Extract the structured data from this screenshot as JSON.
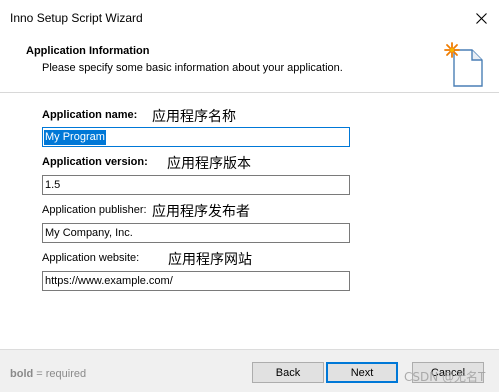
{
  "window": {
    "title": "Inno Setup Script Wizard",
    "close_icon": "close-icon"
  },
  "header": {
    "title": "Application Information",
    "subtitle": "Please specify some basic information about your application.",
    "icon": "wizard-document-sparkle-icon"
  },
  "fields": {
    "name": {
      "label": "Application name:",
      "annotation": "应用程序名称",
      "value": "My Program",
      "required": true
    },
    "version": {
      "label": "Application version:",
      "annotation": "应用程序版本",
      "value": "1.5",
      "required": true
    },
    "publisher": {
      "label": "Application publisher:",
      "annotation": "应用程序发布者",
      "value": "My Company, Inc.",
      "required": false
    },
    "website": {
      "label": "Application website:",
      "annotation": "应用程序网站",
      "value": "https://www.example.com/",
      "required": false
    }
  },
  "footer": {
    "legend_bold": "bold",
    "legend_rest": " = required",
    "back_label": "Back",
    "next_label": "Next",
    "cancel_label": "Cancel",
    "watermark": "CSDN @无名T"
  },
  "colors": {
    "focus_blue": "#0078d7",
    "footer_bg": "#f0f0f0",
    "icon_orange": "#f07c00"
  }
}
